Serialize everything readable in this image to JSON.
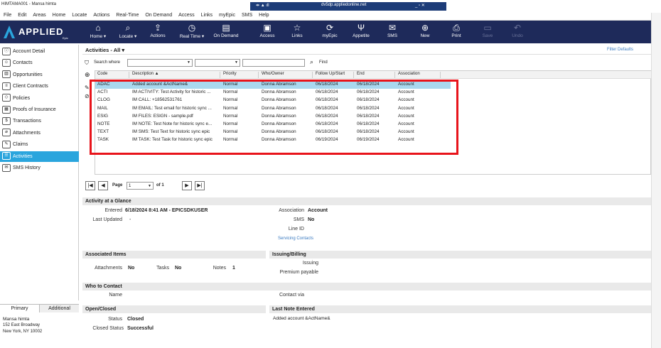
{
  "window": {
    "title": "HIMTAMA001 - Mansa himta",
    "remote_title": "dv5dp.appliedonline.net"
  },
  "menu": [
    "File",
    "Edit",
    "Areas",
    "Home",
    "Locate",
    "Actions",
    "Real-Time",
    "On Demand",
    "Access",
    "Links",
    "myEpic",
    "SMS",
    "Help"
  ],
  "logo": {
    "main": "APPLIED",
    "sub": "Epic"
  },
  "toolbar": [
    {
      "label": "Home ▾",
      "icon": "home-icon",
      "glyph": "⌂"
    },
    {
      "label": "Locate ▾",
      "icon": "search-icon",
      "glyph": "⌕"
    },
    {
      "label": "Actions",
      "icon": "share-icon",
      "glyph": "⇪"
    },
    {
      "label": "Real Time ▾",
      "icon": "clock-icon",
      "glyph": "◷"
    },
    {
      "label": "On Demand",
      "icon": "document-icon",
      "glyph": "▤"
    },
    {
      "label": "Access",
      "icon": "access-icon",
      "glyph": "▣"
    },
    {
      "label": "Links",
      "icon": "star-icon",
      "glyph": "☆"
    },
    {
      "label": "myEpic",
      "icon": "sync-icon",
      "glyph": "⟳"
    },
    {
      "label": "Appetite",
      "icon": "utensils-icon",
      "glyph": "Ψ"
    },
    {
      "label": "SMS",
      "icon": "sms-icon",
      "glyph": "✉"
    },
    {
      "label": "New",
      "icon": "plus-icon",
      "glyph": "⊕"
    },
    {
      "label": "Print",
      "icon": "printer-icon",
      "glyph": "⎙"
    },
    {
      "label": "Save",
      "icon": "save-icon",
      "glyph": "▭",
      "disabled": true
    },
    {
      "label": "Undo",
      "icon": "undo-icon",
      "glyph": "↶",
      "disabled": true
    }
  ],
  "sidebar": {
    "items": [
      {
        "label": "Account Detail",
        "icon": "person-icon",
        "glyph": "ⓘ"
      },
      {
        "label": "Contacts",
        "icon": "contacts-icon",
        "glyph": "☺"
      },
      {
        "label": "Opportunities",
        "icon": "chart-icon",
        "glyph": "▥"
      },
      {
        "label": "Client Contracts",
        "icon": "contract-icon",
        "glyph": "≡"
      },
      {
        "label": "Policies",
        "icon": "shield-icon",
        "glyph": "◇"
      },
      {
        "label": "Proofs of Insurance",
        "icon": "proof-icon",
        "glyph": "▦"
      },
      {
        "label": "Transactions",
        "icon": "dollar-icon",
        "glyph": "$"
      },
      {
        "label": "Attachments",
        "icon": "paperclip-icon",
        "glyph": "⌀"
      },
      {
        "label": "Claims",
        "icon": "claims-icon",
        "glyph": "✎"
      },
      {
        "label": "Activities",
        "icon": "activities-icon",
        "glyph": "☰",
        "selected": true
      },
      {
        "label": "SMS History",
        "icon": "sms-history-icon",
        "glyph": "✉"
      }
    ]
  },
  "customer": {
    "tabs": [
      "Primary",
      "Additional"
    ],
    "name": "Mansa himta",
    "address1": "152 East Broadway",
    "address2": "New York, NY  10002"
  },
  "activities": {
    "title": "Activities - All ▾",
    "filter_defaults": "Filter Defaults",
    "search_label": "Search where",
    "find_label": "Find",
    "columns": [
      "Code",
      "Description  ▲",
      "Priority",
      "Who/Owner",
      "Follow Up/Start",
      "End",
      "Association"
    ],
    "rows": [
      [
        "ADAC",
        "Added account &ActName&",
        "Normal",
        "Donna Abramson",
        "06/18/2024",
        "06/18/2024",
        "Account"
      ],
      [
        "ACTI",
        "IM ACTIVITY: Test Activity for historic ...",
        "Normal",
        "Donna Abramson",
        "06/18/2024",
        "06/18/2024",
        "Account"
      ],
      [
        "CLOG",
        "IM CALL: +18562531761",
        "Normal",
        "Donna Abramson",
        "06/18/2024",
        "06/18/2024",
        "Account"
      ],
      [
        "MAIL",
        "IM EMAIL: Test email for historic sync ...",
        "Normal",
        "Donna Abramson",
        "06/18/2024",
        "06/18/2024",
        "Account"
      ],
      [
        "ESIG",
        "IM FILES: ESIGN - sample.pdf",
        "Normal",
        "Donna Abramson",
        "06/18/2024",
        "06/18/2024",
        "Account"
      ],
      [
        "NOTE",
        "IM NOTE: Test Note for historic sync e...",
        "Normal",
        "Donna Abramson",
        "06/18/2024",
        "06/18/2024",
        "Account"
      ],
      [
        "TEXT",
        "IM SMS: Test Text for historic sync epic",
        "Normal",
        "Donna Abramson",
        "06/18/2024",
        "06/18/2024",
        "Account"
      ],
      [
        "TASK",
        "IM TASK: Test Task for historic sync epic",
        "Normal",
        "Donna Abramson",
        "06/19/2024",
        "06/19/2024",
        "Account"
      ]
    ],
    "pager": {
      "page_label": "Page",
      "page_value": "1",
      "of_label": "of 1"
    }
  },
  "glance": {
    "title": "Activity at a Glance",
    "entered_label": "Entered",
    "entered_value": "6/18/2024 8:41 AM - EPICSDKUSER",
    "last_updated_label": "Last Updated",
    "last_updated_value": "-",
    "association_label": "Association",
    "association_value": "Account",
    "sms_label": "SMS",
    "sms_value": "No",
    "line_id_label": "Line ID",
    "servicing_contacts": "Servicing Contacts"
  },
  "associated": {
    "title": "Associated Items",
    "attachments_label": "Attachments",
    "attachments_value": "No",
    "tasks_label": "Tasks",
    "tasks_value": "No",
    "notes_label": "Notes",
    "notes_value": "1"
  },
  "issuing": {
    "title": "Issuing/Billing",
    "issuing_label": "Issuing",
    "premium_label": "Premium payable"
  },
  "who": {
    "title": "Who to Contact",
    "name_label": "Name",
    "contact_via_label": "Contact via"
  },
  "open_closed": {
    "title": "Open/Closed",
    "status_label": "Status",
    "status_value": "Closed",
    "closed_status_label": "Closed Status",
    "closed_status_value": "Successful"
  },
  "last_note": {
    "title": "Last Note Entered",
    "value": "Added account &ActName&"
  },
  "colors": {
    "toolbar": "#1e2a5a",
    "selection": "#2aa5dd",
    "highlight": "#e8141b",
    "row_selected": "#a9d8ef"
  }
}
